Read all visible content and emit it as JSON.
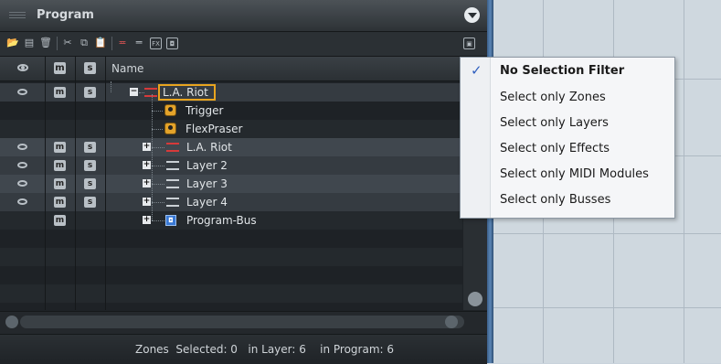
{
  "panel": {
    "title": "Program",
    "column_header_name": "Name",
    "header_icons": {
      "mute": "m",
      "solo": "s"
    }
  },
  "toolbar": {
    "icons": [
      "open-folder-icon",
      "save-icon",
      "delete-icon",
      "cut-icon",
      "copy-icon",
      "paste-icon",
      "new-layer-icon",
      "layer-icon",
      "fx-icon",
      "bus-icon",
      "collapse-icon"
    ],
    "fx_label": "FX"
  },
  "tree": [
    {
      "label": "L.A. Riot",
      "type": "layer-red",
      "level": 0,
      "expander": "−",
      "mute": "m",
      "solo": "s",
      "selected": true
    },
    {
      "label": "Trigger",
      "type": "module",
      "level": 1
    },
    {
      "label": "FlexPraser",
      "type": "module",
      "level": 1
    },
    {
      "label": "L.A. Riot",
      "type": "layer-red",
      "level": 1,
      "expander": "+",
      "mute": "m",
      "solo": "s"
    },
    {
      "label": "Layer 2",
      "type": "layer-white",
      "level": 1,
      "expander": "+",
      "mute": "m",
      "solo": "s"
    },
    {
      "label": "Layer 3",
      "type": "layer-white",
      "level": 1,
      "expander": "+",
      "mute": "m",
      "solo": "s"
    },
    {
      "label": "Layer 4",
      "type": "layer-white",
      "level": 1,
      "expander": "+",
      "mute": "m",
      "solo": "s"
    },
    {
      "label": "Program-Bus",
      "type": "bus",
      "level": 1,
      "expander": "+",
      "mute": "m"
    }
  ],
  "status": {
    "text": "Zones  Selected: 0   in Layer: 6    in Program: 6"
  },
  "menu": {
    "items": [
      {
        "label": "No Selection Filter",
        "checked": true
      },
      {
        "label": "Select only Zones"
      },
      {
        "label": "Select only Layers"
      },
      {
        "label": "Select only Effects"
      },
      {
        "label": "Select only MIDI Modules"
      },
      {
        "label": "Select only Busses"
      }
    ],
    "check_glyph": "✓"
  },
  "colors": {
    "accent": "#e8a41f",
    "layer_red": "#d63a3a",
    "bus_blue": "#3878d4",
    "check": "#2f5fbf"
  }
}
